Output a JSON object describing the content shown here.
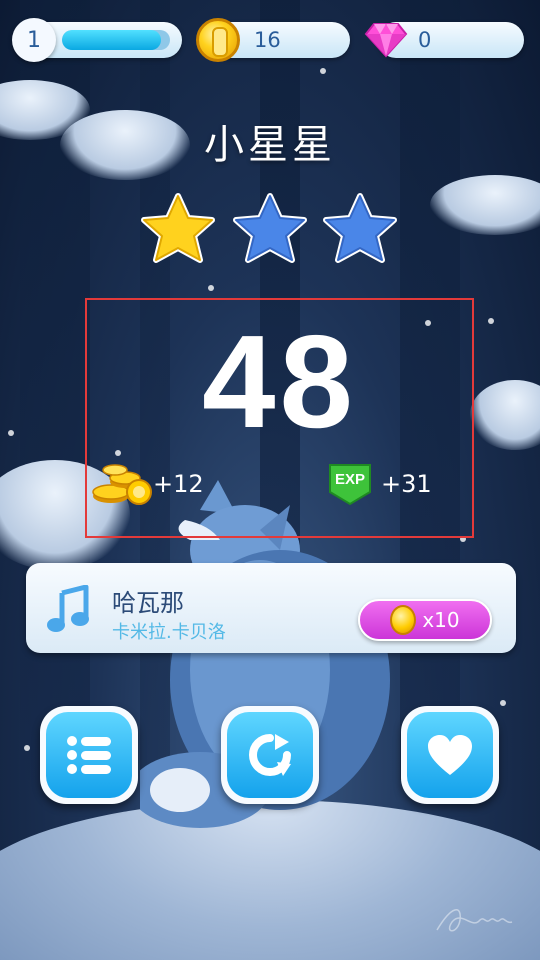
{
  "topbar": {
    "level": "1",
    "xp_progress": 0.92,
    "coins": "16",
    "gems": "0",
    "icons": [
      "coin-icon",
      "gem-icon"
    ]
  },
  "result": {
    "song_title": "小星星",
    "stars_earned": 1,
    "stars_total": 3,
    "score": "48",
    "coin_reward": "+12",
    "exp_reward": "+31",
    "exp_badge": "EXP"
  },
  "song_card": {
    "title": "哈瓦那",
    "artist": "卡米拉.卡贝洛",
    "buy_label": "x10",
    "icon": "music-note-icon"
  },
  "actions": {
    "icons": [
      "list-icon",
      "replay-icon",
      "heart-icon"
    ]
  },
  "colors": {
    "accent": "#14a2ec",
    "gold_star": "#ffd21e",
    "empty_star": "#4a86e8",
    "buy_button": "#cc35d8",
    "highlight_border": "#e33a3a"
  }
}
